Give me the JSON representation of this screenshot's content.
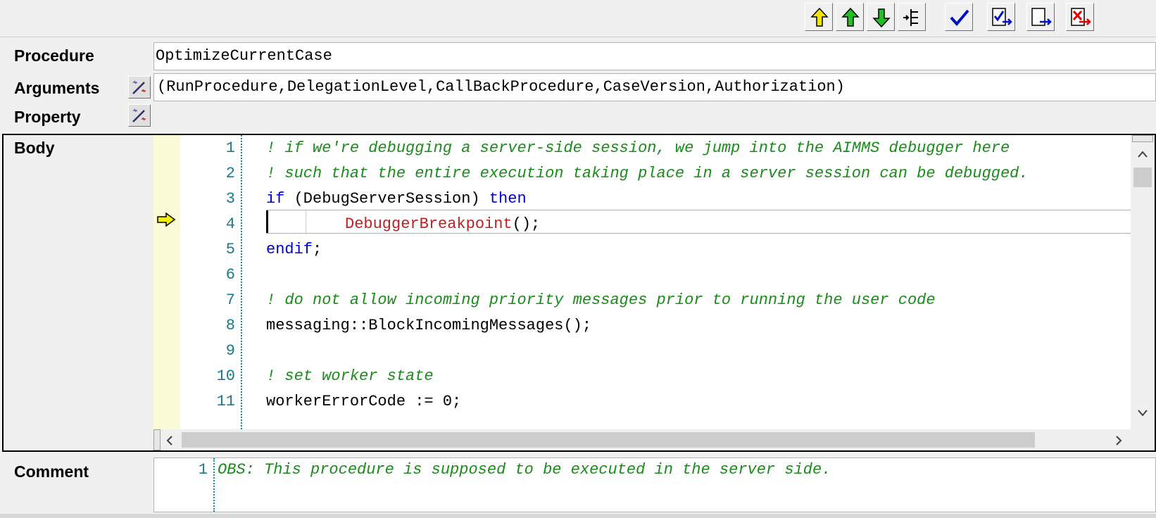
{
  "toolbar": {
    "buttons": [
      {
        "name": "move-up-level",
        "icon": "arrow-up-left-yellow-icon"
      },
      {
        "name": "move-up",
        "icon": "arrow-up-green-icon"
      },
      {
        "name": "move-down",
        "icon": "arrow-down-green-icon"
      },
      {
        "name": "outline",
        "icon": "tree-outline-icon"
      },
      {
        "name": "check",
        "icon": "checkmark-icon"
      },
      {
        "name": "check-and-commit",
        "icon": "check-commit-icon"
      },
      {
        "name": "commit",
        "icon": "commit-icon"
      },
      {
        "name": "discard",
        "icon": "discard-icon"
      }
    ]
  },
  "procedure": {
    "label": "Procedure",
    "value": "OptimizeCurrentCase"
  },
  "arguments": {
    "label": "Arguments",
    "value": "(RunProcedure,DelegationLevel,CallBackProcedure,CaseVersion,Authorization)"
  },
  "property": {
    "label": "Property",
    "value": ""
  },
  "body": {
    "label": "Body",
    "lines": [
      {
        "n": "1",
        "text": "! if we're debugging a server-side session, we jump into the AIMMS debugger here",
        "kind": "comment"
      },
      {
        "n": "2",
        "text": "! such that the entire execution taking place in a server session can be debugged.",
        "kind": "comment"
      },
      {
        "n": "3",
        "text_kw": "if",
        "text_rest": " (DebugServerSession) ",
        "text_kw2": "then",
        "kind": "if"
      },
      {
        "n": "4",
        "text_fn": "DebuggerBreakpoint",
        "text_rest": "();",
        "kind": "call"
      },
      {
        "n": "5",
        "text_kw": "endif",
        "text_rest": ";",
        "kind": "endif"
      },
      {
        "n": "6",
        "text": "",
        "kind": "blank"
      },
      {
        "n": "7",
        "text": "! do not allow incoming priority messages prior to running the user code",
        "kind": "comment"
      },
      {
        "n": "8",
        "text": "messaging::BlockIncomingMessages();",
        "kind": "plain"
      },
      {
        "n": "9",
        "text": "",
        "kind": "blank"
      },
      {
        "n": "10",
        "text": "! set worker state",
        "kind": "comment"
      },
      {
        "n": "11",
        "text": "workerErrorCode := 0;",
        "kind": "plain"
      }
    ]
  },
  "comment": {
    "label": "Comment",
    "line_no": "1",
    "text": "OBS: This procedure is supposed to be executed in the server side."
  },
  "colors": {
    "comment": "#1a8c1a",
    "keyword": "#0000d0",
    "function": "#c02020",
    "line_number": "#1a7a8a",
    "gutter": "#fbfbd8"
  }
}
